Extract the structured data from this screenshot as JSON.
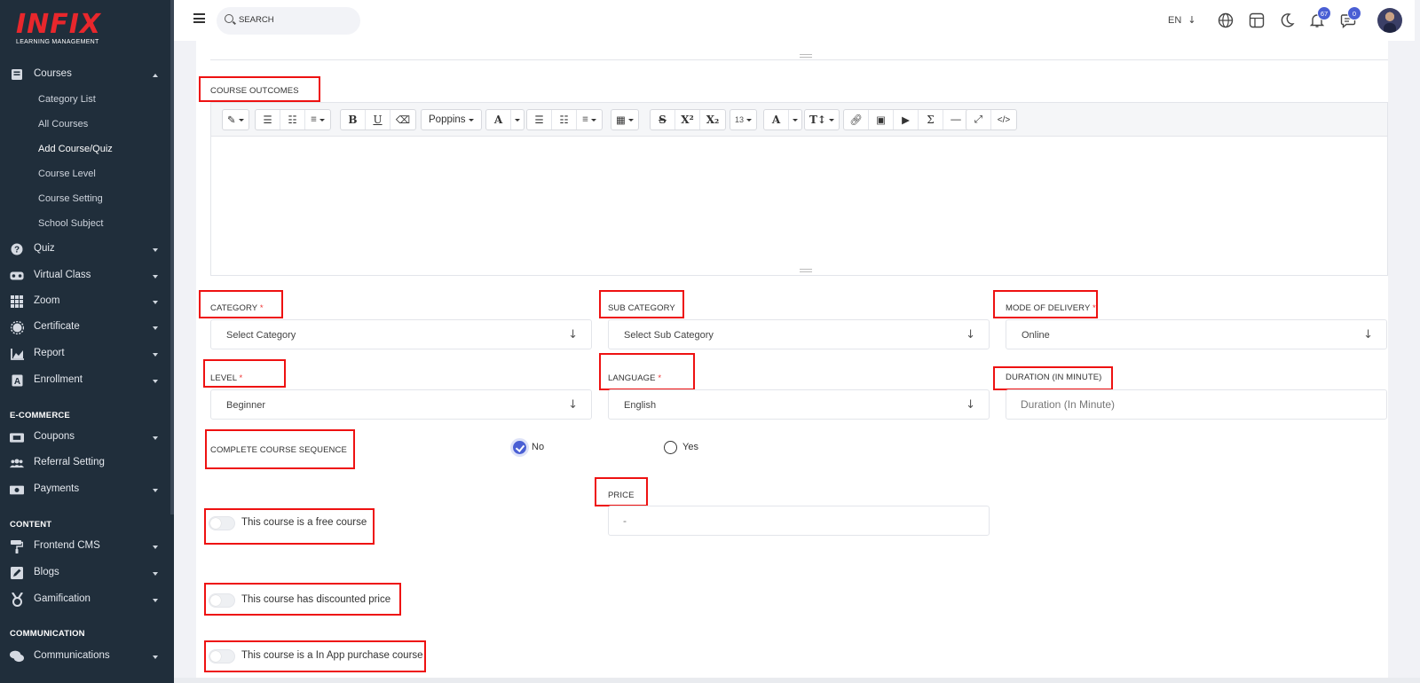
{
  "brand": {
    "logo": "INFIX",
    "tagline": "LEARNING MANAGEMENT",
    "logo_color": "#e8272c"
  },
  "sidebar": {
    "courses": {
      "label": "Courses",
      "subitems": [
        "Category List",
        "All Courses",
        "Add Course/Quiz",
        "Course Level",
        "Course Setting",
        "School Subject"
      ],
      "active": "Add Course/Quiz"
    },
    "items": [
      {
        "label": "Quiz",
        "icon": "question-circle-icon"
      },
      {
        "label": "Virtual Class",
        "icon": "vr-headset-icon"
      },
      {
        "label": "Zoom",
        "icon": "grid-icon"
      },
      {
        "label": "Certificate",
        "icon": "certificate-icon"
      },
      {
        "label": "Report",
        "icon": "chart-icon"
      },
      {
        "label": "Enrollment",
        "icon": "enrollment-icon"
      }
    ],
    "ecommerce": {
      "heading": "E-COMMERCE",
      "items": [
        {
          "label": "Coupons",
          "icon": "ticket-icon"
        },
        {
          "label": "Referral Setting",
          "icon": "users-icon"
        },
        {
          "label": "Payments",
          "icon": "money-icon"
        }
      ]
    },
    "content": {
      "heading": "CONTENT",
      "items": [
        {
          "label": "Frontend CMS",
          "icon": "paint-roller-icon"
        },
        {
          "label": "Blogs",
          "icon": "edit-icon"
        },
        {
          "label": "Gamification",
          "icon": "medal-icon"
        }
      ]
    },
    "communication": {
      "heading": "COMMUNICATION",
      "items": [
        {
          "label": "Communications",
          "icon": "comments-icon"
        }
      ]
    }
  },
  "header": {
    "search_placeholder": "SEARCH",
    "language": "EN",
    "notification_count": "67",
    "message_count": "0",
    "accent": "#4a5fd4"
  },
  "form": {
    "course_outcomes_label": "COURSE OUTCOMES",
    "editor": {
      "font_name": "Poppins",
      "font_size": "13"
    },
    "category": {
      "label": "CATEGORY",
      "value": "Select Category"
    },
    "sub_category": {
      "label": "SUB CATEGORY",
      "value": "Select Sub Category"
    },
    "mode_of_delivery": {
      "label": "MODE OF DELIVERY",
      "value": "Online"
    },
    "level": {
      "label": "LEVEL",
      "value": "Beginner"
    },
    "language": {
      "label": "LANGUAGE",
      "value": "English"
    },
    "duration": {
      "label": "DURATION (IN MINUTE)",
      "placeholder": "Duration (In Minute)"
    },
    "sequence": {
      "label": "COMPLETE COURSE SEQUENCE",
      "options": [
        "No",
        "Yes"
      ],
      "selected": "No"
    },
    "price": {
      "label": "PRICE",
      "placeholder": "-"
    },
    "toggles": {
      "free": "This course is a free course",
      "discounted": "This course has discounted price",
      "in_app": "This course is a In App purchase course"
    },
    "required_mark": "*"
  }
}
